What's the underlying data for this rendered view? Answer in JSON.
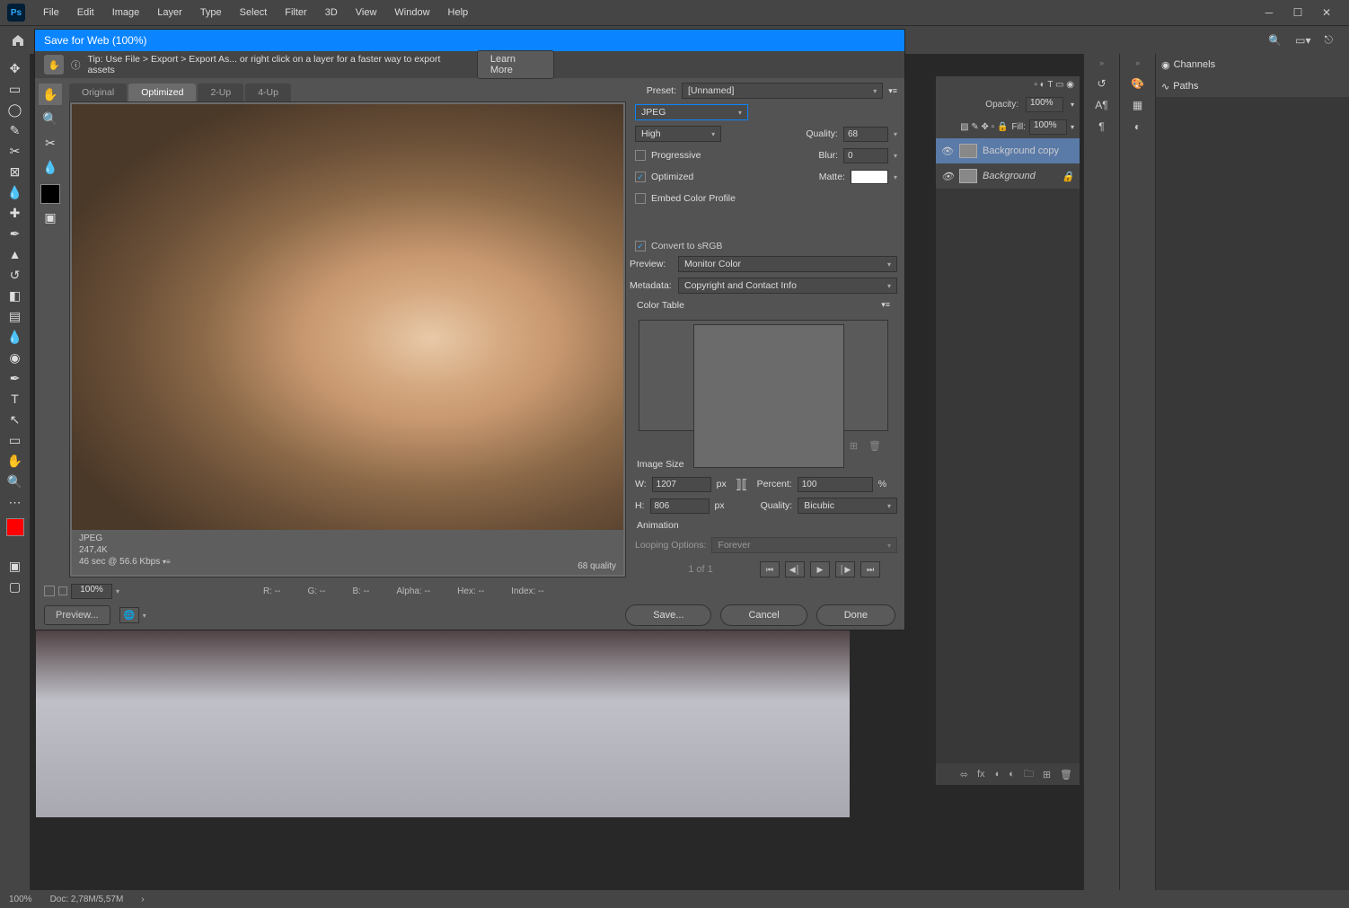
{
  "menubar": {
    "items": [
      "File",
      "Edit",
      "Image",
      "Layer",
      "Type",
      "Select",
      "Filter",
      "3D",
      "View",
      "Window",
      "Help"
    ]
  },
  "dialog": {
    "title": "Save for Web (100%)",
    "tip_text": "Tip: Use File > Export > Export As...   or right click on a layer for a faster way to export assets",
    "learn_more": "Learn More",
    "preview_tabs": {
      "original": "Original",
      "optimized": "Optimized",
      "two_up": "2-Up",
      "four_up": "4-Up"
    },
    "preview_footer": {
      "format": "JPEG",
      "size": "247,4K",
      "time": "46 sec @ 56.6 Kbps",
      "quality": "68 quality"
    },
    "preset_label": "Preset:",
    "preset_value": "[Unnamed]",
    "format_value": "JPEG",
    "quality_mode": "High",
    "progressive": "Progressive",
    "optimized": "Optimized",
    "embed": "Embed Color Profile",
    "quality_label": "Quality:",
    "quality_value": "68",
    "blur_label": "Blur:",
    "blur_value": "0",
    "matte_label": "Matte:",
    "convert_srgb": "Convert to sRGB",
    "preview_label": "Preview:",
    "preview_value": "Monitor Color",
    "metadata_label": "Metadata:",
    "metadata_value": "Copyright and Contact Info",
    "color_table": "Color Table",
    "image_size": "Image Size",
    "w_label": "W:",
    "w_value": "1207",
    "px": "px",
    "h_label": "H:",
    "h_value": "806",
    "percent_label": "Percent:",
    "percent_value": "100",
    "pct": "%",
    "isq_label": "Quality:",
    "isq_value": "Bicubic",
    "animation": "Animation",
    "loop_label": "Looping Options:",
    "loop_value": "Forever",
    "frame_info": "1 of 1",
    "rgb": {
      "r": "R: --",
      "g": "G: --",
      "b": "B: --",
      "alpha": "Alpha: --",
      "hex": "Hex: --",
      "index": "Index: --"
    },
    "zoom": "100%",
    "preview_btn": "Preview...",
    "save": "Save...",
    "cancel": "Cancel",
    "done": "Done"
  },
  "layers": {
    "opacity_label": "Opacity:",
    "opacity_value": "100%",
    "fill_label": "Fill:",
    "fill_value": "100%",
    "items": [
      {
        "name": "Background copy",
        "selected": true,
        "locked": false,
        "italic": false
      },
      {
        "name": "Background",
        "selected": false,
        "locked": true,
        "italic": true
      }
    ]
  },
  "panels": {
    "channels": "Channels",
    "paths": "Paths"
  },
  "status": {
    "zoom": "100%",
    "doc": "Doc: 2,78M/5,57M"
  }
}
